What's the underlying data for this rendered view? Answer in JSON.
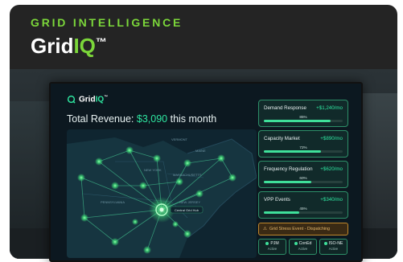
{
  "brand": {
    "eyebrow": "GRID INTELLIGENCE",
    "title_prefix": "Grid",
    "title_accent": "IQ",
    "title_tm": "™"
  },
  "screen": {
    "logo_prefix": "Grid",
    "logo_accent": "IQ",
    "logo_tm": "™",
    "revenue_label": "Total Revenue:",
    "revenue_amount": "$3,090",
    "revenue_suffix": "this month",
    "map_hub_label": "Central Grid Hub",
    "map_regions": [
      "NEW YORK",
      "MASSACHUSETTS",
      "PENNSYLVANIA",
      "VERMONT",
      "NEW JERSEY",
      "MAINE"
    ],
    "panels": [
      {
        "label": "Demand Response",
        "value": "+$1,240/mo",
        "pct_label": "85%",
        "pct": 85
      },
      {
        "label": "Capacity Market",
        "value": "+$890/mo",
        "pct_label": "72%",
        "pct": 72
      },
      {
        "label": "Frequency Regulation",
        "value": "+$620/mo",
        "pct_label": "60%",
        "pct": 60
      },
      {
        "label": "VPP Events",
        "value": "+$340/mo",
        "pct_label": "45%",
        "pct": 45
      }
    ],
    "alert": "Grid Stress Event - Dispatching",
    "systems": [
      {
        "name": "PJM",
        "status": "Active"
      },
      {
        "name": "ConEd",
        "status": "Active"
      },
      {
        "name": "ISO-NE",
        "status": "Active"
      }
    ],
    "colors": {
      "accent": "#2ee6a0",
      "brand_green": "#7bd63a",
      "alert": "#c0872c"
    }
  }
}
